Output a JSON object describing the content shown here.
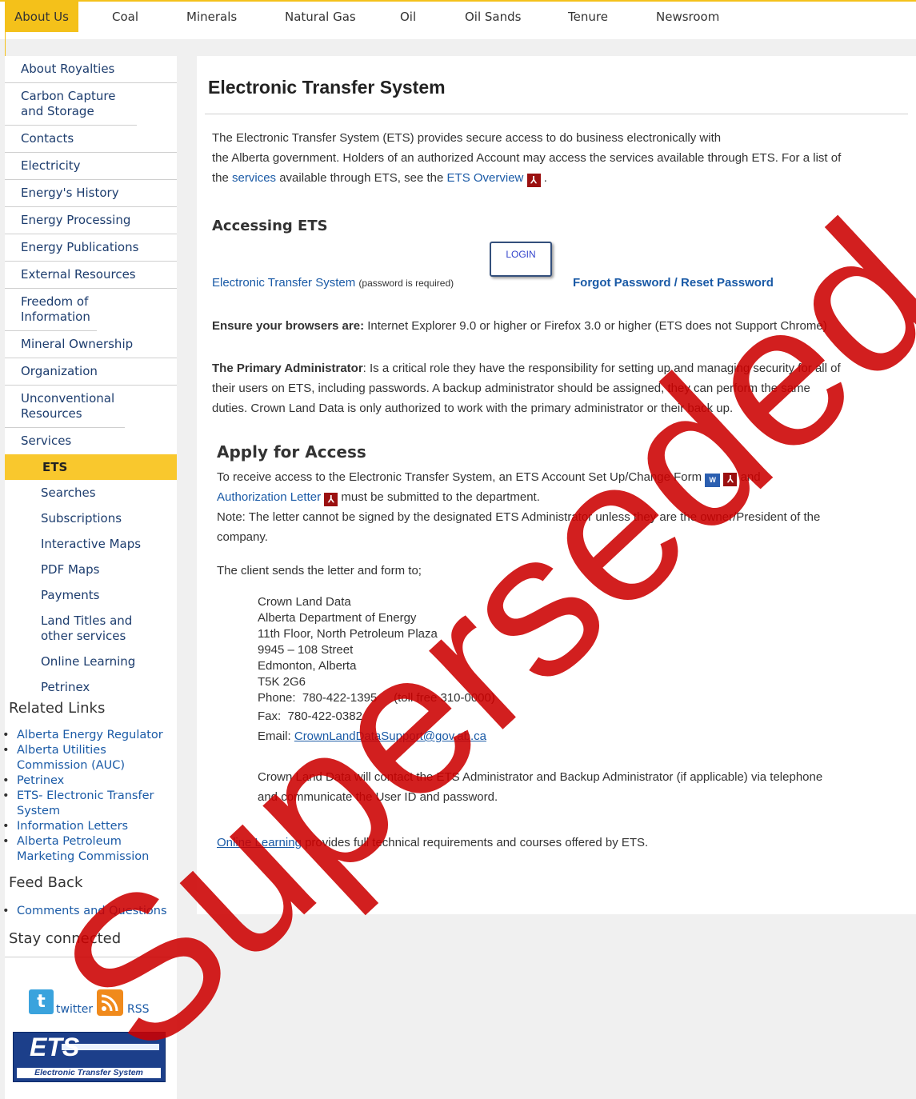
{
  "top_nav": [
    "About Us",
    "Coal",
    "Minerals",
    "Natural Gas",
    "Oil",
    "Oil Sands",
    "Tenure",
    "Newsroom"
  ],
  "sidebar": {
    "items": [
      "About Royalties",
      "Carbon Capture and Storage",
      "Contacts",
      "Electricity",
      "Energy's History",
      "Energy Processing",
      "Energy Publications",
      "External Resources",
      "Freedom of Information",
      "Mineral Ownership",
      "Organization",
      "Unconventional Resources",
      "Services"
    ],
    "sub_items": [
      "ETS",
      "Searches",
      "Subscriptions",
      "Interactive Maps",
      "PDF Maps",
      "Payments",
      "Land Titles and other services",
      "Online Learning",
      "Petrinex"
    ],
    "related_heading": "Related Links",
    "related_links": [
      "Alberta Energy Regulator",
      "Alberta Utilities Commission (AUC)",
      "Petrinex",
      "ETS- Electronic Transfer System",
      "Information Letters",
      "Alberta Petroleum Marketing Commission"
    ],
    "feedback_heading": "Feed Back",
    "feedback_links": [
      "Comments and Questions"
    ],
    "stay_heading": "Stay connected",
    "twitter": "twitter",
    "rss": "RSS",
    "ets_logo_big": "ETS",
    "ets_logo_sub": "Electronic Transfer System"
  },
  "main": {
    "title": "Electronic Transfer System",
    "intro_1": "The Electronic Transfer System (ETS) provides secure access to do business electronically with",
    "intro_2": "the Alberta government. Holders of an authorized Account may access the services available through ETS. For a list of",
    "intro_3_pre": "the",
    "intro_3_link1": "services",
    "intro_3_mid": "available through ETS, see the",
    "intro_3_link2": "ETS Overview",
    "accessing_heading": "Accessing ETS",
    "ets_link": "Electronic Transfer System",
    "password_note": "(password is required)",
    "login_label": "LOGIN",
    "forgot_link": "Forgot Password / Reset Password",
    "browsers_bold": "Ensure your browsers are:",
    "browsers_text": "Internet Explorer 9.0 or higher or Firefox 3.0 or higher (ETS does not Support Chrome)",
    "admin_bold": "The Primary Administrator",
    "admin_1": ": Is a critical role they have the responsibility for setting up and managing security for all of",
    "admin_2": "their users on ETS, including passwords. A backup administrator should be assigned, they can perform the same",
    "admin_3": "duties. Crown Land Data is only authorized to work with the primary administrator or their back up.",
    "apply_heading": "Apply for Access",
    "apply_1": "To receive access to the Electronic Transfer System, an ETS Account Set Up/Change Form",
    "apply_1_and": "and",
    "apply_2_link": "Authorization Letter",
    "apply_2_text": "must be submitted to the department.",
    "note_1": "Note: The letter cannot be signed by the designated ETS Administrator unless they are the owner/President of the",
    "note_2": "company.",
    "client_sends": "The client sends the letter and form to;",
    "address": [
      "Crown Land Data",
      "Alberta Department of Energy",
      "11th Floor, North Petroleum Plaza",
      "9945 – 108 Street",
      "Edmonton, Alberta",
      "T5K 2G6"
    ],
    "phone": "Phone:  780-422-1395     (toll free 310-0000)",
    "fax": "Fax:  780-422-0382",
    "email_label": "Email:",
    "email": "CrownLandDataSupport@gov.ab.ca",
    "contact_1": "Crown Land Data will contact the ETS Administrator and Backup Administrator (if applicable) via telephone",
    "contact_2": "and communicate the User ID and password.",
    "online_link": "Online Learning",
    "online_text": "provides full technical requirements and courses offered by ETS."
  },
  "watermark": "Superseded",
  "colors": {
    "accent": "#f4c11a",
    "link": "#1a5aa6",
    "watermark": "#cc0000"
  }
}
